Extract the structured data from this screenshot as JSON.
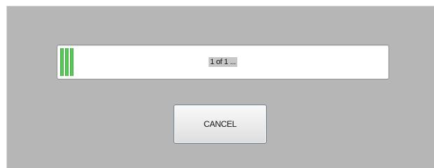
{
  "progress": {
    "status_text": "1 of 1 ...",
    "fill_fraction": 0.05,
    "fill_color": "#3fae3f"
  },
  "buttons": {
    "cancel_label": "CANCEL"
  },
  "colors": {
    "dialog_background": "#b6b6b6",
    "progress_track": "#ffffff"
  }
}
